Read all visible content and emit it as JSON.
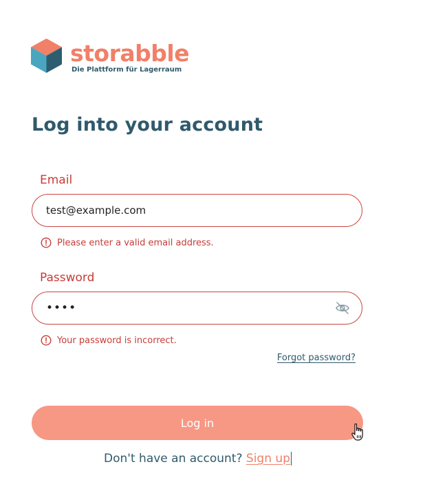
{
  "logo": {
    "wordmark": "storabble",
    "tagline": "Die Plattform für Lagerraum",
    "cube_top_color": "#f08068",
    "cube_left_color": "#4aa6bf",
    "cube_right_color": "#2d5e70"
  },
  "page": {
    "title": "Log into your account"
  },
  "email": {
    "label": "Email",
    "value": "test@example.com",
    "error": "Please enter a valid email address."
  },
  "password": {
    "label": "Password",
    "value": "••••",
    "toggle_icon": "eye-slash-icon",
    "error": "Your password is incorrect."
  },
  "forgot_password": {
    "label": "Forgot password?"
  },
  "login_button": {
    "label": "Log in"
  },
  "signup": {
    "prompt": "Don't have an account?",
    "link_label": "Sign up"
  },
  "colors": {
    "brand": "#f08068",
    "text_primary": "#2f5a6b",
    "error": "#c63c37",
    "button": "#f79884"
  }
}
